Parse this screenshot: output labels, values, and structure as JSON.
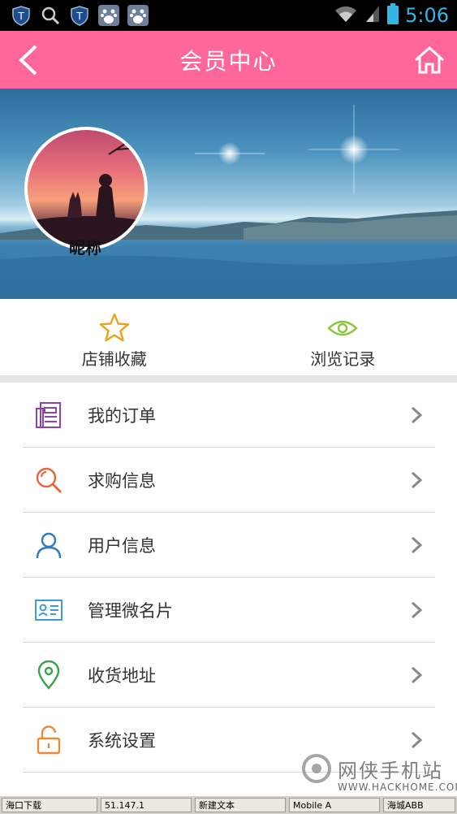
{
  "status_bar": {
    "time": "5:06"
  },
  "header": {
    "title": "会员中心"
  },
  "profile": {
    "nickname": "昵称"
  },
  "quick_actions": [
    {
      "label": "店铺收藏",
      "icon": "star-icon"
    },
    {
      "label": "浏览记录",
      "icon": "eye-icon"
    }
  ],
  "menu": [
    {
      "label": "我的订单",
      "icon": "order-document-icon"
    },
    {
      "label": "求购信息",
      "icon": "search-icon"
    },
    {
      "label": "用户信息",
      "icon": "user-icon"
    },
    {
      "label": "管理微名片",
      "icon": "business-card-icon"
    },
    {
      "label": "收货地址",
      "icon": "location-pin-icon"
    },
    {
      "label": "系统设置",
      "icon": "unlock-icon"
    }
  ],
  "watermark": {
    "text": "网侠手机站",
    "url": "WWW.HACKHOME.COM"
  },
  "taskbar": {
    "items": [
      "海口下载",
      "51.147.1",
      "新建文本",
      "Mobile A",
      "海城ABB"
    ]
  },
  "colors": {
    "accent": "#ff6699",
    "status_time": "#33b5e5",
    "star": "#e8a31e",
    "eye": "#8cc63f"
  }
}
